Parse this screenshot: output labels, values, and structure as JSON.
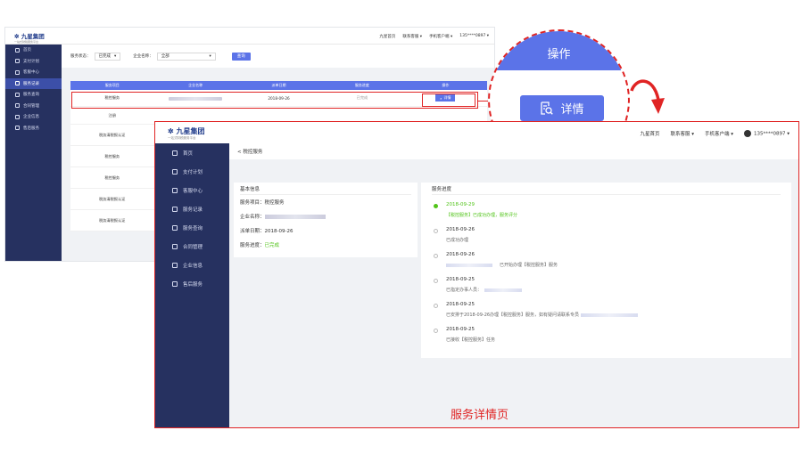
{
  "bg_page": {
    "logo": "九星集团",
    "logo_sub": "一站式财税服务平台",
    "header_links": [
      "九星首页",
      "联系客服 ▾",
      "手机客户端 ▾",
      "135****0897 ▾"
    ],
    "sidebar": [
      "首页",
      "支付计划",
      "客服中心",
      "服务记录",
      "服务查询",
      "合同管理",
      "企业信息",
      "售后服务"
    ],
    "sidebar_active": 3,
    "filter": {
      "status_label": "服务状态：",
      "status_value": "已完成",
      "company_label": "企业名称：",
      "company_value": "全部",
      "query_button": "查询"
    },
    "table_headers": [
      "服务项目",
      "企业名称",
      "派单日期",
      "服务进度",
      "操作"
    ],
    "rows": [
      {
        "item": "税控服务",
        "date": "2018-09-26",
        "progress": "已完成",
        "action": "详情"
      },
      {
        "item": "注册",
        "date": "",
        "progress": "",
        "action": ""
      },
      {
        "item": "税务清税报认证",
        "date": "",
        "progress": "",
        "action": ""
      },
      {
        "item": "税控服务",
        "date": "",
        "progress": "",
        "action": ""
      },
      {
        "item": "税控服务",
        "date": "",
        "progress": "",
        "action": ""
      },
      {
        "item": "税务清税报认证",
        "date": "",
        "progress": "",
        "action": ""
      },
      {
        "item": "税务清税报认证",
        "date": "",
        "progress": "",
        "action": ""
      }
    ]
  },
  "zoom": {
    "header": "操作",
    "button": "详情"
  },
  "front_page": {
    "logo": "九星集团",
    "logo_sub": "一站式财税服务平台",
    "header_links": [
      "九星首页",
      "联系客服 ▾",
      "手机客户端 ▾",
      "135****0897 ▾"
    ],
    "sidebar": [
      "首页",
      "支付计划",
      "客服中心",
      "服务记录",
      "服务查询",
      "合同管理",
      "企业信息",
      "售后服务"
    ],
    "breadcrumb": "< 税控服务",
    "basic": {
      "title": "基本信息",
      "item": "服务项目：税控服务",
      "company": "企业名称：",
      "date": "派单日期：2018-09-26",
      "progress_label": "服务进度：",
      "progress_value": "已完成"
    },
    "progress": {
      "title": "服务进度",
      "steps": [
        {
          "date": "2018-09-29",
          "desc": "【税控服务】已成功办理，服务评分",
          "active": true
        },
        {
          "date": "2018-09-26",
          "desc": "已成功办理",
          "active": false
        },
        {
          "date": "2018-09-26",
          "desc": "已开始办理【税控服务】服务",
          "active": false
        },
        {
          "date": "2018-09-25",
          "desc": "已指定办事人员：",
          "active": false
        },
        {
          "date": "2018-09-25",
          "desc": "已安排于2018-09-26办理【税控服务】服务，如有疑问请联系专员",
          "active": false
        },
        {
          "date": "2018-09-25",
          "desc": "已接收【税控服务】任务",
          "active": false
        }
      ]
    },
    "caption": "服务详情页"
  },
  "colors": {
    "accent": "#5b73e8",
    "sidebar": "#263160",
    "highlight": "#e02424",
    "success": "#52c41a"
  }
}
